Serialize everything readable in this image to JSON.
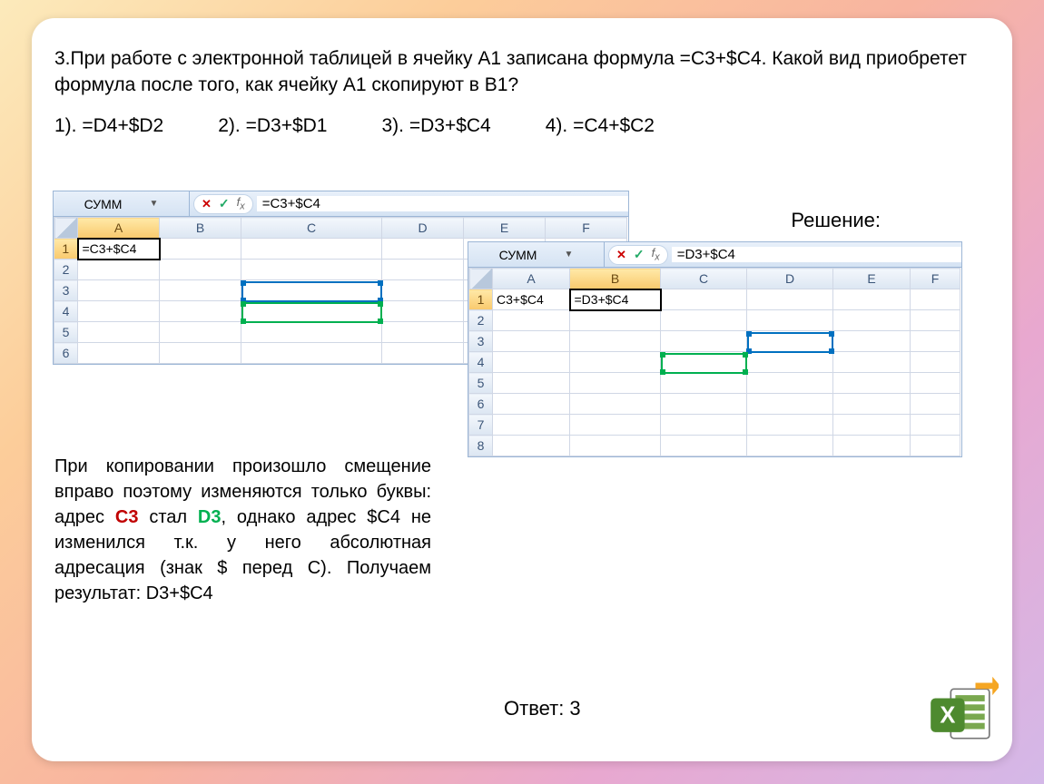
{
  "question": "3.При работе с электронной таблицей в ячейку А1 записана формула =С3+$С4. Какой вид приобретет формула после того, как  ячейку А1 скопируют в В1?",
  "options": {
    "o1": "1). =D4+$D2",
    "o2": "2). =D3+$D1",
    "o3": "3). =D3+$С4",
    "o4": "4). =C4+$С2"
  },
  "solution_label": "Решение:",
  "excel1": {
    "namebox": "СУММ",
    "formula": "=C3+$C4",
    "cols": [
      "A",
      "B",
      "C",
      "D",
      "E",
      "F"
    ],
    "rows": [
      "1",
      "2",
      "3",
      "4",
      "5",
      "6"
    ],
    "a1": "=C3+$C4"
  },
  "excel2": {
    "namebox": "СУММ",
    "formula": "=D3+$C4",
    "cols": [
      "A",
      "B",
      "C",
      "D",
      "E",
      "F"
    ],
    "rows": [
      "1",
      "2",
      "3",
      "4",
      "5",
      "6",
      "7",
      "8"
    ],
    "a1": "C3+$C4",
    "b1": "=D3+$C4"
  },
  "explain": {
    "t1": "При копировании произошло смещение вправо поэтому изменяются только буквы: адрес ",
    "c3": "С3",
    "t2": " стал ",
    "d3": "D3",
    "t3": ", однако адрес $С4 не изменился т.к. у него абсолютная адресация (знак $ перед С). Получаем результат: D3+$С4"
  },
  "answer": "Ответ: 3"
}
